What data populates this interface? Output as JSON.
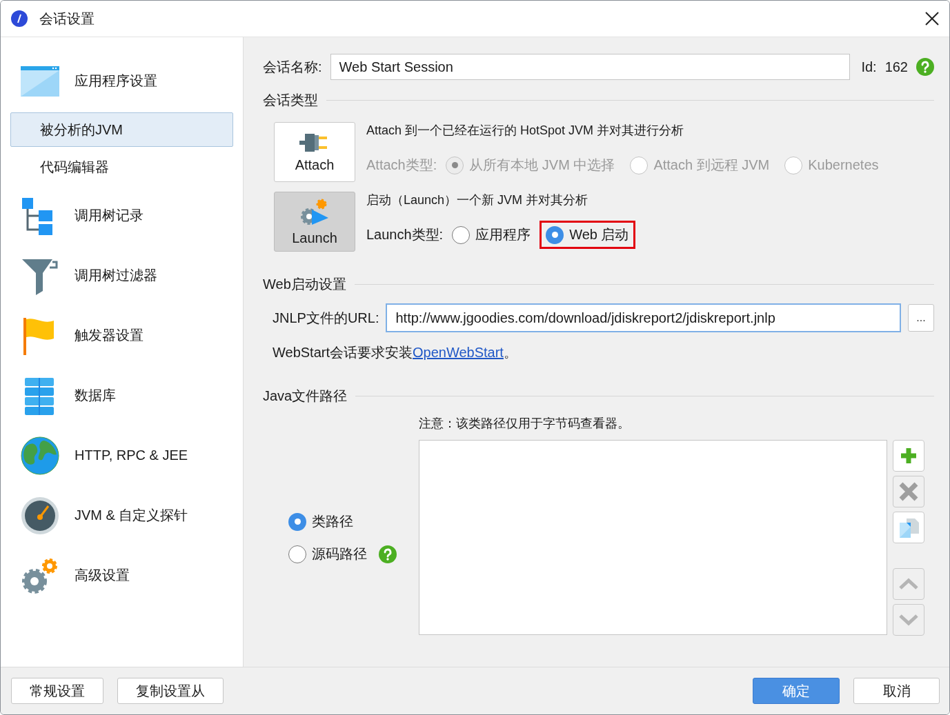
{
  "window": {
    "title": "会话设置"
  },
  "sidebar": {
    "items": [
      {
        "label": "应用程序设置",
        "kind": "window",
        "selected": false
      },
      {
        "label": "被分析的JVM",
        "kind": "sub",
        "selected": true
      },
      {
        "label": "代码编辑器",
        "kind": "sub",
        "selected": false
      },
      {
        "label": "调用树记录",
        "kind": "tree",
        "selected": false
      },
      {
        "label": "调用树过滤器",
        "kind": "funnel",
        "selected": false
      },
      {
        "label": "触发器设置",
        "kind": "flag",
        "selected": false
      },
      {
        "label": "数据库",
        "kind": "database",
        "selected": false
      },
      {
        "label": "HTTP, RPC & JEE",
        "kind": "globe",
        "selected": false
      },
      {
        "label": "JVM & 自定义探针",
        "kind": "gauge",
        "selected": false
      },
      {
        "label": "高级设置",
        "kind": "gears",
        "selected": false
      }
    ]
  },
  "session": {
    "name_label": "会话名称:",
    "name_value": "Web Start Session",
    "id_label": "Id:",
    "id_value": "162"
  },
  "session_type": {
    "title": "会话类型",
    "modes": [
      {
        "kind": "attach",
        "button_label": "Attach",
        "selected": false,
        "description": "Attach 到一个已经在运行的 HotSpot JVM 并对其进行分析",
        "type_label": "Attach类型:",
        "disabled": true,
        "options": [
          {
            "label": "从所有本地 JVM 中选择",
            "selected": true,
            "highlighted": false
          },
          {
            "label": "Attach 到远程 JVM",
            "selected": false,
            "highlighted": false
          },
          {
            "label": "Kubernetes",
            "selected": false,
            "highlighted": false
          }
        ]
      },
      {
        "kind": "launch",
        "button_label": "Launch",
        "selected": true,
        "description": "启动（Launch）一个新 JVM 并对其分析",
        "type_label": "Launch类型:",
        "disabled": false,
        "options": [
          {
            "label": "应用程序",
            "selected": false,
            "highlighted": false
          },
          {
            "label": "Web 启动",
            "selected": true,
            "highlighted": true
          }
        ]
      }
    ]
  },
  "web_start": {
    "title": "Web启动设置",
    "url_label": "JNLP文件的URL:",
    "url_value": "http://www.jgoodies.com/download/jdiskreport2/jdiskreport.jnlp",
    "browse_button": "...",
    "note_prefix": "WebStart会话要求安装",
    "link": "OpenWebStart",
    "note_suffix": "。"
  },
  "java_file_path": {
    "title": "Java文件路径",
    "note": "注意：该类路径仅用于字节码查看器。",
    "path_options": [
      {
        "label": "类路径",
        "selected": true,
        "help": false
      },
      {
        "label": "源码路径",
        "selected": false,
        "help": true
      }
    ],
    "list_buttons": [
      {
        "kind": "add",
        "disabled": false
      },
      {
        "kind": "remove",
        "disabled": true
      },
      {
        "kind": "copy",
        "disabled": false
      },
      {
        "kind": "up",
        "disabled": true
      },
      {
        "kind": "down",
        "disabled": true
      }
    ]
  },
  "footer": {
    "left_buttons": [
      "常规设置",
      "复制设置从"
    ],
    "ok": "确定",
    "cancel": "取消"
  }
}
